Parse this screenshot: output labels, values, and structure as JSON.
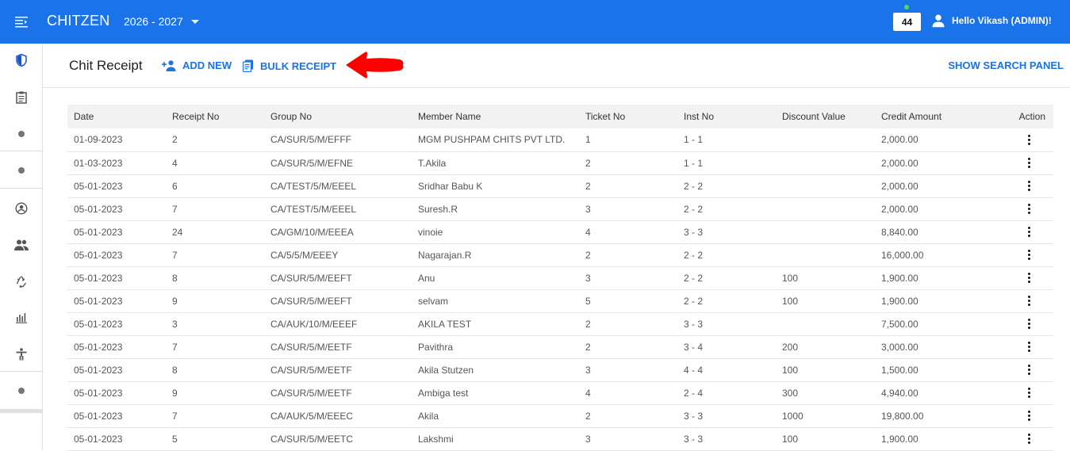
{
  "header": {
    "brand": "CHITZEN",
    "year": "2026 - 2027",
    "notification_count": "44",
    "user_greeting": "Hello Vikash (ADMIN)!",
    "bar_color": "#1a73e8"
  },
  "sidebar": {
    "items": [
      {
        "icon": "shield-icon"
      },
      {
        "icon": "clipboard-icon"
      },
      {
        "icon": "dot-icon"
      },
      {
        "icon": "dot-icon"
      },
      {
        "icon": "account-circle-icon"
      },
      {
        "icon": "people-icon"
      },
      {
        "icon": "recycle-icon"
      },
      {
        "icon": "bar-chart-icon"
      },
      {
        "icon": "accessibility-icon"
      },
      {
        "icon": "dot-icon"
      }
    ]
  },
  "page": {
    "title": "Chit Receipt",
    "add_new_label": "ADD NEW",
    "bulk_receipt_label": "BULK RECEIPT",
    "search_panel_label": "SHOW SEARCH PANEL",
    "annotation_arrow_color": "#ff0000"
  },
  "table": {
    "columns": [
      "Date",
      "Receipt No",
      "Group No",
      "Member Name",
      "Ticket No",
      "Inst No",
      "Discount Value",
      "Credit Amount",
      "Action"
    ],
    "rows": [
      [
        "01-09-2023",
        "2",
        "CA/SUR/5/M/EFFF",
        "MGM PUSHPAM CHITS PVT LTD.",
        "1",
        "1 - 1",
        "",
        "2,000.00"
      ],
      [
        "01-03-2023",
        "4",
        "CA/SUR/5/M/EFNE",
        "T.Akila",
        "2",
        "1 - 1",
        "",
        "2,000.00"
      ],
      [
        "05-01-2023",
        "6",
        "CA/TEST/5/M/EEEL",
        "Sridhar Babu K",
        "2",
        "2 - 2",
        "",
        "2,000.00"
      ],
      [
        "05-01-2023",
        "7",
        "CA/TEST/5/M/EEEL",
        "Suresh.R",
        "3",
        "2 - 2",
        "",
        "2,000.00"
      ],
      [
        "05-01-2023",
        "24",
        "CA/GM/10/M/EEEA",
        "vinoie",
        "4",
        "3 - 3",
        "",
        "8,840.00"
      ],
      [
        "05-01-2023",
        "7",
        "CA/5/5/M/EEEY",
        "Nagarajan.R",
        "2",
        "2 - 2",
        "",
        "16,000.00"
      ],
      [
        "05-01-2023",
        "8",
        "CA/SUR/5/M/EEFT",
        "Anu",
        "3",
        "2 - 2",
        "100",
        "1,900.00"
      ],
      [
        "05-01-2023",
        "9",
        "CA/SUR/5/M/EEFT",
        "selvam",
        "5",
        "2 - 2",
        "100",
        "1,900.00"
      ],
      [
        "05-01-2023",
        "3",
        "CA/AUK/10/M/EEEF",
        "AKILA TEST",
        "2",
        "3 - 3",
        "",
        "7,500.00"
      ],
      [
        "05-01-2023",
        "7",
        "CA/SUR/5/M/EETF",
        "Pavithra",
        "2",
        "3 - 4",
        "200",
        "3,000.00"
      ],
      [
        "05-01-2023",
        "8",
        "CA/SUR/5/M/EETF",
        "Akila Stutzen",
        "3",
        "4 - 4",
        "100",
        "1,500.00"
      ],
      [
        "05-01-2023",
        "9",
        "CA/SUR/5/M/EETF",
        "Ambiga test",
        "4",
        "2 - 4",
        "300",
        "4,940.00"
      ],
      [
        "05-01-2023",
        "7",
        "CA/AUK/5/M/EEEC",
        "Akila",
        "2",
        "3 - 3",
        "1000",
        "19,800.00"
      ],
      [
        "05-01-2023",
        "5",
        "CA/SUR/5/M/EETC",
        "Lakshmi",
        "3",
        "3 - 3",
        "100",
        "1,900.00"
      ]
    ]
  }
}
